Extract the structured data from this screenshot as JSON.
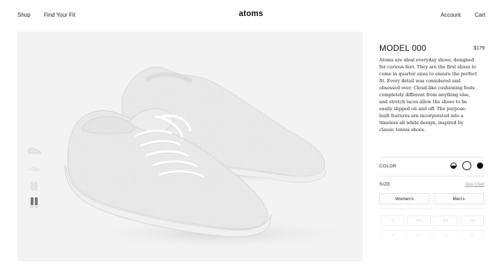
{
  "header": {
    "nav_left": [
      "Shop",
      "Find Your Fit"
    ],
    "logo": "atoms",
    "nav_right": [
      "Account",
      "Cart"
    ]
  },
  "hero": {
    "thumbnails": [
      "side-view",
      "sole-view",
      "pair-top-view",
      "worn-view"
    ],
    "background": "#f3f3f3"
  },
  "product": {
    "name": "MODEL 000",
    "price": "$179",
    "description_lines": [
      "Atoms are ideal everyday shoes, designed",
      "for curious feet. They are the first shoes to",
      "come in quarter sizes to ensure the perfect",
      "fit. Every detail was considered and",
      "obsessed over. Cloud-like cushioning feels",
      "completely different from anything else,",
      "and stretch laces allow the shoes to be",
      "easily slipped on and off. The purpose-",
      "built features are incorporated into a",
      "timeless all white design, inspired by",
      "classic tennis shoes."
    ]
  },
  "color": {
    "label": "COLOR",
    "options": [
      "half-white-half-black",
      "white",
      "black"
    ],
    "selected": "white"
  },
  "size": {
    "label": "SIZE",
    "chart_link": "Size Chart",
    "tabs": [
      "Women's",
      "Men's"
    ],
    "grid": [
      "5",
      "5¼",
      "5½",
      "5¾",
      "6",
      "6¼",
      "6½",
      "6¾"
    ]
  },
  "colors": {
    "text": "#111111",
    "muted": "#999999",
    "border": "#e2e2e2"
  }
}
